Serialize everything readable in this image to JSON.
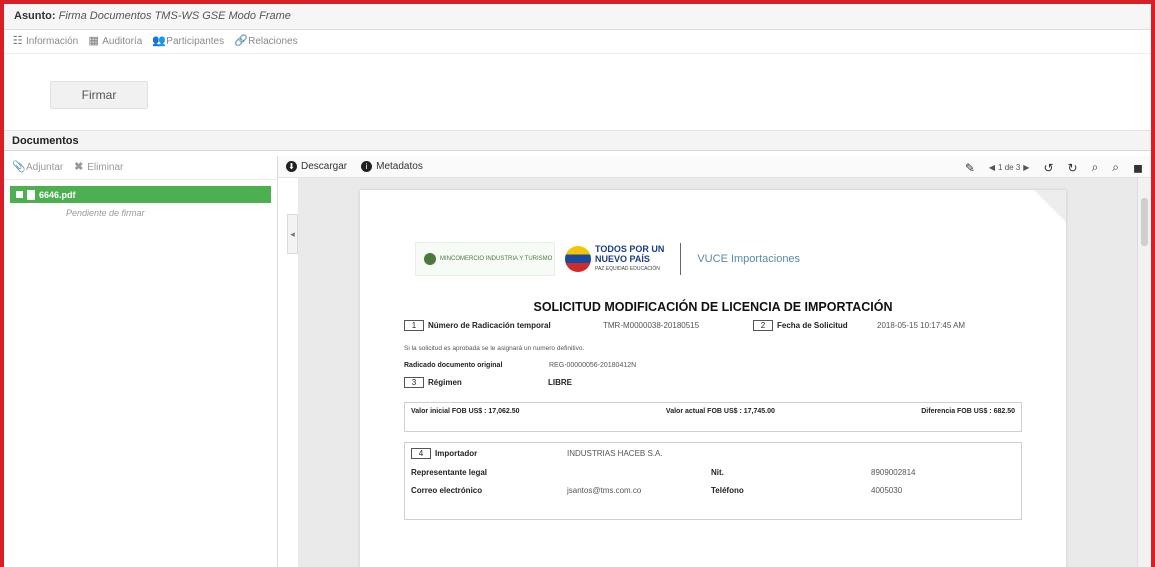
{
  "header": {
    "subject_label": "Asunto:",
    "subject_value": "Firma Documentos TMS-WS GSE Modo Frame"
  },
  "tabs": [
    {
      "label": "Información"
    },
    {
      "label": "Auditoría"
    },
    {
      "label": "Participantes"
    },
    {
      "label": "Relaciones"
    }
  ],
  "actions": {
    "sign_label": "Firmar"
  },
  "documents": {
    "title": "Documentos",
    "attach_label": "Adjuntar",
    "delete_label": "Eliminar",
    "file_name": "6646.pdf",
    "file_status": "Pendiente de firmar"
  },
  "viewer": {
    "download_label": "Descargar",
    "metadata_label": "Metadatos",
    "page_indicator": "1 de 3"
  },
  "pdf": {
    "mincit_text": "MINCOMERCIO INDUSTRIA Y TURISMO",
    "pais_line1": "TODOS POR UN",
    "pais_line2": "NUEVO PAÍS",
    "pais_small": "PAZ EQUIDAD EDUCACIÓN",
    "vuce": "VUCE Importaciones",
    "title": "SOLICITUD MODIFICACIÓN DE LICENCIA DE IMPORTACIÓN",
    "f1_num": "1",
    "f1_label": "Número de Radicación temporal",
    "f1_value": "TMR-M0000038-20180515",
    "f2_num": "2",
    "f2_label": "Fecha de Solicitud",
    "f2_value": "2018-05-15 10:17:45 AM",
    "note": "Si la solicitud es aprobada se le asignará un numero definitivo.",
    "orig_label": "Radicado documento original",
    "orig_value": "REG-00000056-20180412N",
    "f3_num": "3",
    "f3_label": "Régimen",
    "f3_value": "LIBRE",
    "val_initial": "Valor inicial FOB US$ : 17,062.50",
    "val_actual": "Valor actual FOB US$ : 17,745.00",
    "val_diff": "Diferencia FOB US$ : 682.50",
    "f4_num": "4",
    "f4_label": "Importador",
    "f4_value": "INDUSTRIAS HACEB S.A.",
    "rep_label": "Representante legal",
    "nit_label": "Nit.",
    "nit_value": "8909002814",
    "email_label": "Correo electrónico",
    "email_value": "jsantos@tms.com.co",
    "phone_label": "Teléfono",
    "phone_value": "4005030"
  },
  "colors": {
    "frame": "#d61f26",
    "file_item": "#4caf50"
  }
}
